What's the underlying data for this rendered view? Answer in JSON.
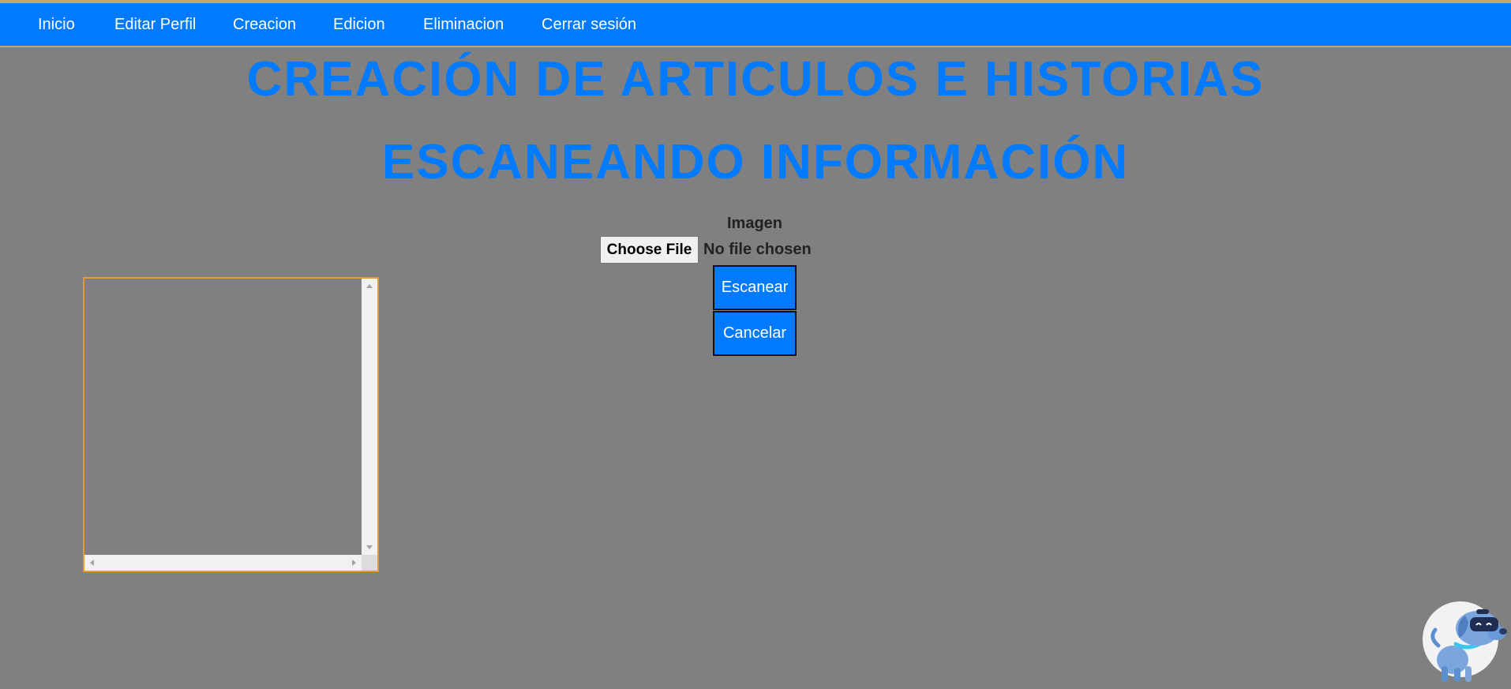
{
  "nav": {
    "items": [
      {
        "label": "Inicio"
      },
      {
        "label": "Editar Perfil"
      },
      {
        "label": "Creacion"
      },
      {
        "label": "Edicion"
      },
      {
        "label": "Eliminacion"
      },
      {
        "label": "Cerrar sesión"
      }
    ]
  },
  "page": {
    "title": "CREACIÓN DE ARTICULOS E HISTORIAS",
    "subtitle": "ESCANEANDO INFORMACIÓN"
  },
  "form": {
    "image_label": "Imagen",
    "file_button": "Choose File",
    "file_status": "No file chosen",
    "scan_button": "Escanear",
    "cancel_button": "Cancelar",
    "textarea_value": ""
  },
  "icons": {
    "mascot": "robot-dog-icon"
  },
  "colors": {
    "accent": "#007bff",
    "background": "#808080",
    "textarea_border": "#e69a28",
    "nav_border": "#c8a46a"
  }
}
